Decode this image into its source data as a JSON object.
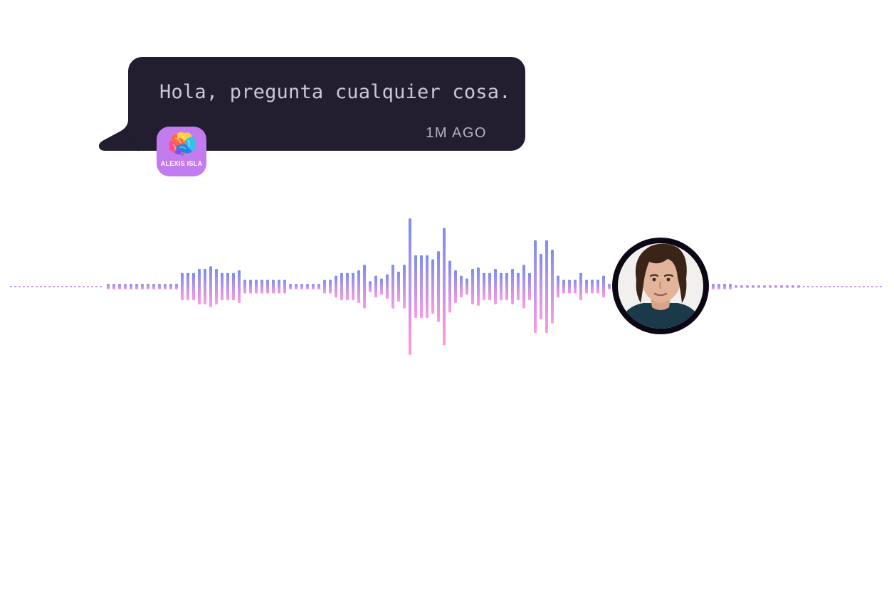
{
  "message": {
    "text": "Hola, pregunta cualquier cosa.",
    "time": "1M AGO",
    "text_color": "#cdc7d3",
    "time_color": "#b7b0bf",
    "bubble_color": "#231d30"
  },
  "bot_avatar": {
    "label": "ALEXIS ISLA",
    "background": "#c37cf0",
    "icon": "brain-icon"
  },
  "user_avatar": {
    "icon": "user-photo",
    "ring_color": "#0d0715"
  },
  "waveform": {
    "top_color": "#7b8cf4",
    "bottom_color": "#ff9ae0",
    "dash_color": "#b283f0",
    "levels": [
      0.04,
      0.04,
      0.04,
      0.04,
      0.04,
      0.04,
      0.04,
      0.04,
      0.04,
      0.04,
      0.04,
      0.04,
      0.04,
      0.2,
      0.2,
      0.2,
      0.26,
      0.26,
      0.3,
      0.26,
      0.2,
      0.2,
      0.2,
      0.24,
      0.1,
      0.1,
      0.1,
      0.1,
      0.1,
      0.1,
      0.1,
      0.1,
      0.04,
      0.04,
      0.04,
      0.04,
      0.04,
      0.04,
      0.1,
      0.1,
      0.16,
      0.2,
      0.2,
      0.2,
      0.24,
      0.32,
      0.08,
      0.16,
      0.12,
      0.18,
      0.32,
      0.22,
      0.32,
      1.0,
      0.46,
      0.46,
      0.46,
      0.4,
      0.52,
      0.86,
      0.38,
      0.24,
      0.16,
      0.12,
      0.26,
      0.28,
      0.2,
      0.2,
      0.26,
      0.2,
      0.2,
      0.26,
      0.2,
      0.32,
      0.2,
      0.68,
      0.48,
      0.68,
      0.54,
      0.16,
      0.1,
      0.1,
      0.1,
      0.2,
      0.1,
      0.1,
      0.1,
      0.16,
      0.04
    ],
    "trail_levels": [
      0.04,
      0.04,
      0.04,
      0.04,
      0.02,
      0.02,
      0.02,
      0.02,
      0.02,
      0.02,
      0.02,
      0.02,
      0.02,
      0.02,
      0.02,
      0.02
    ]
  }
}
